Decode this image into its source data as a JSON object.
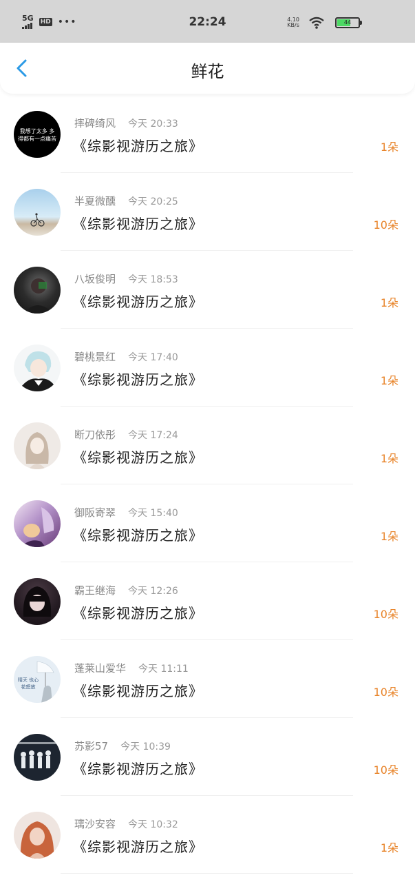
{
  "status_bar": {
    "network": "5G",
    "hd": "HD",
    "dots": "•••",
    "time": "22:24",
    "speed_value": "4.10",
    "speed_unit": "KB/s",
    "battery": "44"
  },
  "header": {
    "title": "鲜花"
  },
  "items": [
    {
      "name": "摔碑绮风",
      "time": "今天 20:33",
      "book": "《综影视游历之旅》",
      "count": "1朵",
      "avatar_text": "我想了太多 多得都有一点痛苦"
    },
    {
      "name": "半夏微醺",
      "time": "今天 20:25",
      "book": "《综影视游历之旅》",
      "count": "10朵"
    },
    {
      "name": "八坂俊明",
      "time": "今天 18:53",
      "book": "《综影视游历之旅》",
      "count": "1朵"
    },
    {
      "name": "碧桃景红",
      "time": "今天 17:40",
      "book": "《综影视游历之旅》",
      "count": "1朵"
    },
    {
      "name": "断刀依彤",
      "time": "今天 17:24",
      "book": "《综影视游历之旅》",
      "count": "1朵"
    },
    {
      "name": "御阪寄翠",
      "time": "今天 15:40",
      "book": "《综影视游历之旅》",
      "count": "1朵"
    },
    {
      "name": "霸王继海",
      "time": "今天 12:26",
      "book": "《综影视游历之旅》",
      "count": "10朵"
    },
    {
      "name": "蓬莱山爱华",
      "time": "今天 11:11",
      "book": "《综影视游历之旅》",
      "count": "10朵",
      "avatar_text": "晴天 也心花怒放"
    },
    {
      "name": "苏影57",
      "time": "今天 10:39",
      "book": "《综影视游历之旅》",
      "count": "10朵"
    },
    {
      "name": "璃沙安容",
      "time": "今天 10:32",
      "book": "《综影视游历之旅》",
      "count": "1朵"
    }
  ],
  "colors": {
    "accent": "#2b9ae6",
    "count": "#e8842a",
    "status_bar_bg": "#d6d6d6"
  }
}
